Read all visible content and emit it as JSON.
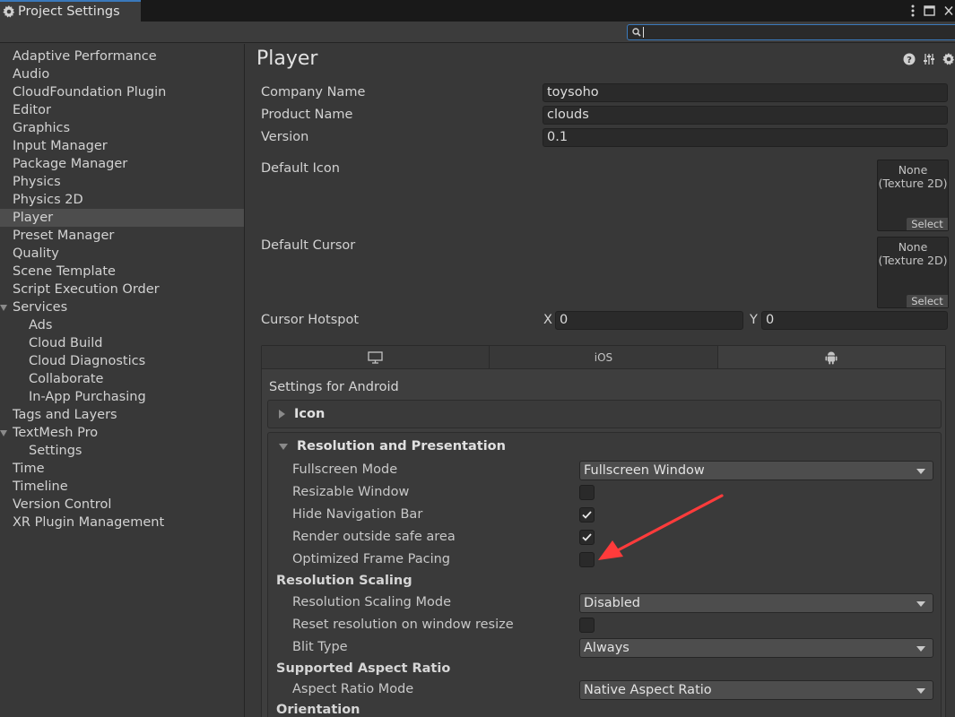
{
  "window": {
    "tab_title": "Project Settings"
  },
  "sidebar": {
    "items": [
      {
        "label": "Adaptive Performance"
      },
      {
        "label": "Audio"
      },
      {
        "label": "CloudFoundation Plugin"
      },
      {
        "label": "Editor"
      },
      {
        "label": "Graphics"
      },
      {
        "label": "Input Manager"
      },
      {
        "label": "Package Manager"
      },
      {
        "label": "Physics"
      },
      {
        "label": "Physics 2D"
      },
      {
        "label": "Player"
      },
      {
        "label": "Preset Manager"
      },
      {
        "label": "Quality"
      },
      {
        "label": "Scene Template"
      },
      {
        "label": "Script Execution Order"
      },
      {
        "label": "Services"
      },
      {
        "label": "Ads"
      },
      {
        "label": "Cloud Build"
      },
      {
        "label": "Cloud Diagnostics"
      },
      {
        "label": "Collaborate"
      },
      {
        "label": "In-App Purchasing"
      },
      {
        "label": "Tags and Layers"
      },
      {
        "label": "TextMesh Pro"
      },
      {
        "label": "Settings"
      },
      {
        "label": "Time"
      },
      {
        "label": "Timeline"
      },
      {
        "label": "Version Control"
      },
      {
        "label": "XR Plugin Management"
      }
    ],
    "selected": "Player"
  },
  "main": {
    "title": "Player",
    "company_name_label": "Company Name",
    "company_name_value": "toysoho",
    "product_name_label": "Product Name",
    "product_name_value": "clouds",
    "version_label": "Version",
    "version_value": "0.1",
    "default_icon_label": "Default Icon",
    "default_cursor_label": "Default Cursor",
    "texture_none": "None",
    "texture_type": "(Texture 2D)",
    "texture_select": "Select",
    "cursor_hotspot_label": "Cursor Hotspot",
    "hotspot_x_label": "X",
    "hotspot_x_value": "0",
    "hotspot_y_label": "Y",
    "hotspot_y_value": "0"
  },
  "platform": {
    "tabs": [
      {
        "icon": "monitor-icon"
      },
      {
        "label": "iOS"
      },
      {
        "icon": "android-icon"
      }
    ],
    "settings_for": "Settings for Android",
    "icon_section": "Icon",
    "resolution_section": "Resolution and Presentation",
    "fullscreen_mode_label": "Fullscreen Mode",
    "fullscreen_mode_value": "Fullscreen Window",
    "resizable_window_label": "Resizable Window",
    "resizable_window_checked": false,
    "hide_nav_bar_label": "Hide Navigation Bar",
    "hide_nav_bar_checked": true,
    "render_outside_label": "Render outside safe area",
    "render_outside_checked": true,
    "optimized_frame_label": "Optimized Frame Pacing",
    "optimized_frame_checked": false,
    "resolution_scaling_header": "Resolution Scaling",
    "resolution_scaling_mode_label": "Resolution Scaling Mode",
    "resolution_scaling_mode_value": "Disabled",
    "reset_resolution_label": "Reset resolution on window resize",
    "reset_resolution_checked": false,
    "blit_type_label": "Blit Type",
    "blit_type_value": "Always",
    "aspect_ratio_header": "Supported Aspect Ratio",
    "aspect_ratio_mode_label": "Aspect Ratio Mode",
    "aspect_ratio_mode_value": "Native Aspect Ratio",
    "orientation_header": "Orientation"
  },
  "colors": {
    "annotation_arrow": "#ff3b3b",
    "accent": "#3a79bb"
  }
}
